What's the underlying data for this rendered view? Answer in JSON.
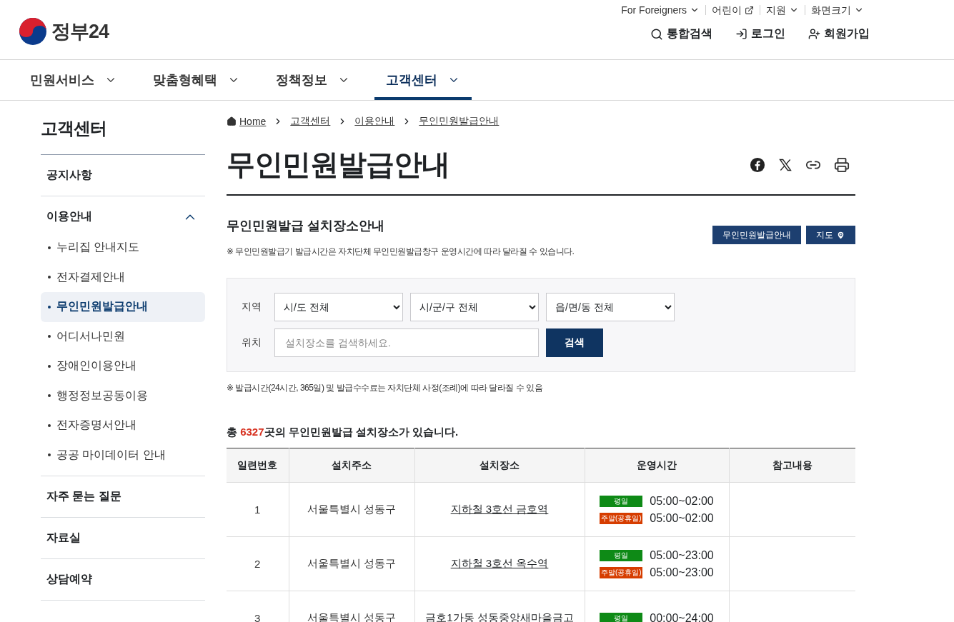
{
  "logo": {
    "text": "정부24"
  },
  "util_links": [
    {
      "label": "For Foreigners"
    },
    {
      "label": "어린이"
    },
    {
      "label": "지원"
    },
    {
      "label": "화면크기"
    }
  ],
  "account_links": [
    {
      "label": "통합검색"
    },
    {
      "label": "로그인"
    },
    {
      "label": "회원가입"
    }
  ],
  "main_nav": [
    {
      "label": "민원서비스",
      "selected": false
    },
    {
      "label": "맞춤형혜택",
      "selected": false
    },
    {
      "label": "정책정보",
      "selected": false
    },
    {
      "label": "고객센터",
      "selected": true
    }
  ],
  "sidebar": {
    "title": "고객센터",
    "items": [
      {
        "label": "공지사항",
        "expanded": false
      },
      {
        "label": "이용안내",
        "expanded": true,
        "children": [
          {
            "label": "누리집 안내지도",
            "selected": false
          },
          {
            "label": "전자결제안내",
            "selected": false
          },
          {
            "label": "무인민원발급안내",
            "selected": true
          },
          {
            "label": "어디서나민원",
            "selected": false
          },
          {
            "label": "장애인이용안내",
            "selected": false
          },
          {
            "label": "행정정보공동이용",
            "selected": false
          },
          {
            "label": "전자증명서안내",
            "selected": false
          },
          {
            "label": "공공 마이데이터 안내",
            "selected": false
          }
        ]
      },
      {
        "label": "자주 묻는 질문",
        "expanded": false
      },
      {
        "label": "자료실",
        "expanded": false
      },
      {
        "label": "상담예약",
        "expanded": false
      }
    ]
  },
  "breadcrumb": [
    "Home",
    "고객센터",
    "이용안내",
    "무인민원발급안내"
  ],
  "page_title": "무인민원발급안내",
  "section": {
    "title": "무인민원발급 설치장소안내",
    "buttons": [
      {
        "label": "무인민원발급안내"
      },
      {
        "label": "지도"
      }
    ],
    "note": "※ 무인민원발급기 발급시간은 자치단체 무인민원발급창구 운영시간에 따라 달라질 수 있습니다."
  },
  "filter": {
    "region_label": "지역",
    "selects": [
      "시/도 전체",
      "시/군/구 전체",
      "읍/면/동 전체"
    ],
    "location_label": "위치",
    "search_placeholder": "설치장소를 검색하세요.",
    "search_button": "검색"
  },
  "filter_note": "※ 발급시간(24시간, 365일) 및 발급수수료는 자치단체 사정(조례)에 따라 달라질 수 있음",
  "total": "총 **6327**곳의 무인민원발급 설치장소가 있습니다.",
  "table": {
    "columns": [
      "일련번호",
      "설치주소",
      "설치장소",
      "운영시간",
      "참고내용"
    ],
    "rows": [
      {
        "no": "1",
        "address": "서울특별시 성동구",
        "place": "지하철 3호선 금호역",
        "hours": [
          {
            "tag": "평일",
            "color": "#0e8a16",
            "time": "05:00~02:00"
          },
          {
            "tag": "주말(공휴일)",
            "color": "#d63d00",
            "time": "05:00~02:00"
          }
        ]
      },
      {
        "no": "2",
        "address": "서울특별시 성동구",
        "place": "지하철 3호선 옥수역",
        "hours": [
          {
            "tag": "평일",
            "color": "#0e8a16",
            "time": "05:00~23:00"
          },
          {
            "tag": "주말(공휴일)",
            "color": "#d63d00",
            "time": "05:00~23:00"
          }
        ]
      },
      {
        "no": "3",
        "address": "서울특별시 성동구",
        "place": "금호1가동 성동중앙새마을금고",
        "hours": [
          {
            "tag": "평일",
            "color": "#0e8a16",
            "time": "00:00~24:00"
          }
        ]
      }
    ]
  }
}
